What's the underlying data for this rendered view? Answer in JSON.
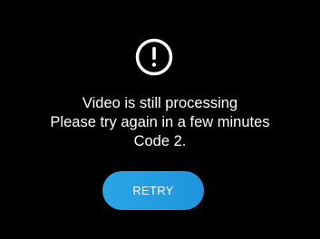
{
  "alert": {
    "icon": "exclamation-circle-icon",
    "line1": "Video is still processing",
    "line2": "Please try again in a few minutes",
    "line3": "Code 2."
  },
  "retry_button": {
    "label": "RETRY"
  },
  "colors": {
    "background": "#000000",
    "text": "#ffffff",
    "button": "#1f94dc"
  }
}
